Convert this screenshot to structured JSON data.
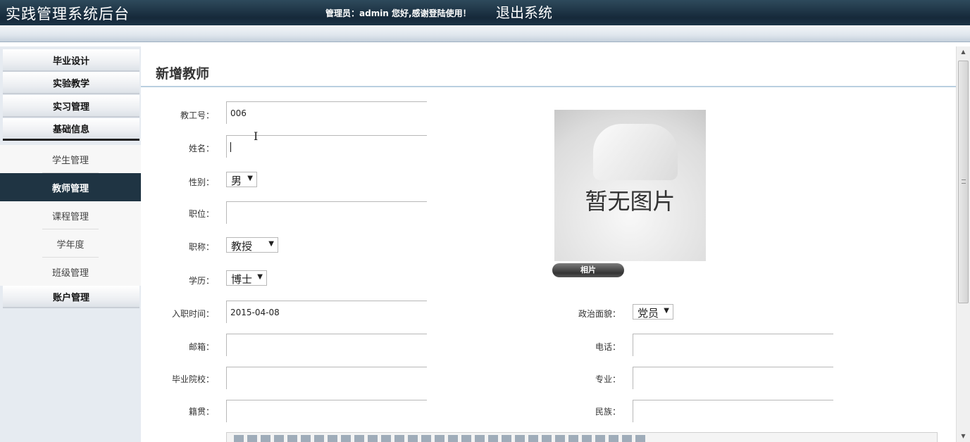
{
  "header": {
    "app_title": "实践管理系统后台",
    "admin_text": "管理员：admin 您好,感谢登陆使用！",
    "logout_label": "退出系统"
  },
  "sidebar": {
    "groups": [
      "毕业设计",
      "实验教学",
      "实习管理",
      "基础信息"
    ],
    "sub_items": [
      "学生管理",
      "教师管理",
      "课程管理",
      "学年度",
      "班级管理"
    ],
    "last_group": "账户管理",
    "active_item": "教师管理"
  },
  "main": {
    "page_title": "新增教师",
    "fields": {
      "employee_no_label": "教工号：",
      "employee_no_value": "006",
      "name_label": "姓名：",
      "name_value": "",
      "gender_label": "性别：",
      "gender_value": "男",
      "position_label": "职位：",
      "position_value": "",
      "title_label": "职称：",
      "title_value": "教授",
      "education_label": "学历：",
      "education_value": "博士",
      "hire_date_label": "入职时间：",
      "hire_date_value": "2015-04-08",
      "political_label": "政治面貌：",
      "political_value": "党员",
      "email_label": "邮箱：",
      "email_value": "",
      "phone_label": "电话：",
      "phone_value": "",
      "school_label": "毕业院校：",
      "school_value": "",
      "major_label": "专业：",
      "major_value": "",
      "native_label": "籍贯：",
      "native_value": "",
      "ethnicity_label": "民族：",
      "ethnicity_value": ""
    },
    "photo": {
      "placeholder_text": "暂无图片",
      "button_label": "相片"
    }
  },
  "colors": {
    "header_bg": "#16293a",
    "active_nav_bg": "#1f3443",
    "title_rule": "#b9cfe0"
  }
}
